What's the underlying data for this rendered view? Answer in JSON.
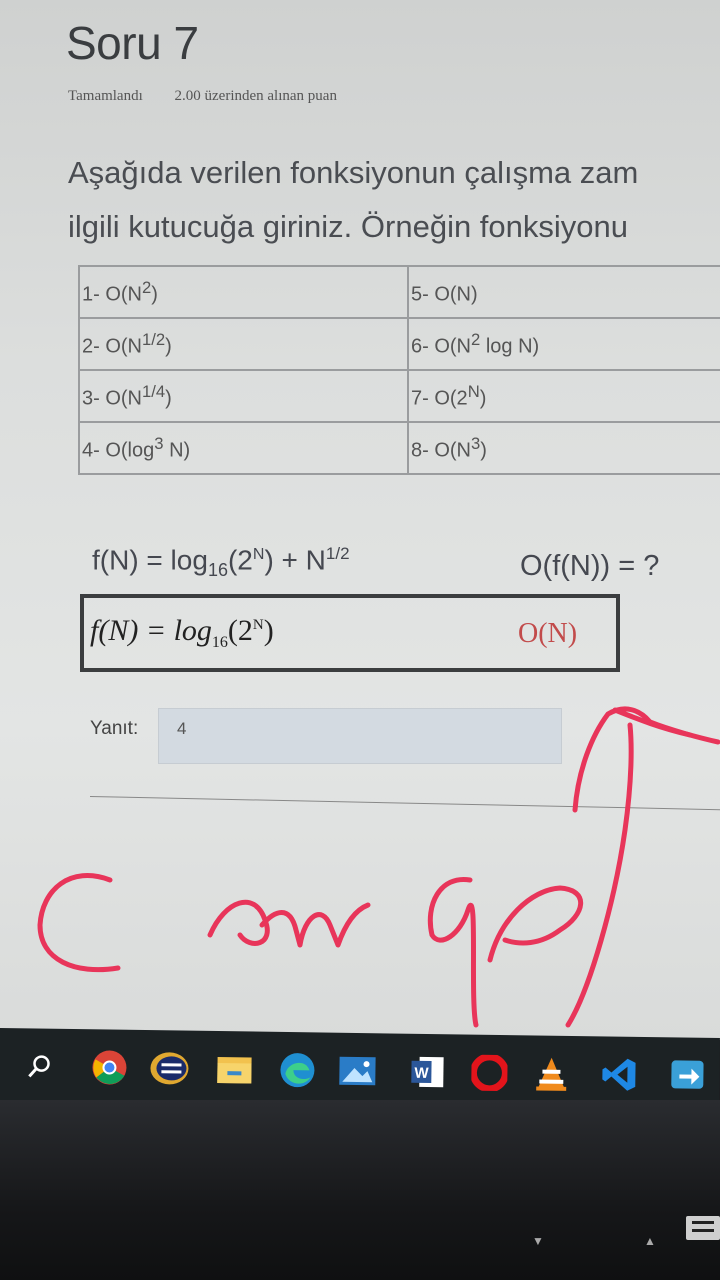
{
  "question": {
    "title": "Soru 7",
    "status": "Tamamlandı",
    "points": "2.00 üzerinden alınan puan",
    "text_line1": "Aşağıda verilen fonksiyonun çalışma zam",
    "text_line2": "ilgili kutucuğa giriniz. Örneğin fonksiyonu"
  },
  "options": {
    "o1": {
      "pre": "1- O(N",
      "sup": "2",
      "post": ")"
    },
    "o2": {
      "pre": "2- O(N",
      "sup": "1/2",
      "post": ")"
    },
    "o3": {
      "pre": "3- O(N",
      "sup": "1/4",
      "post": ")"
    },
    "o4": {
      "pre": "4- O(log",
      "sup": "3",
      "post": " N)"
    },
    "o5": {
      "pre": "5- O(N)",
      "sup": "",
      "post": ""
    },
    "o6": {
      "pre": "6- O(N",
      "sup": "2",
      "post": " log N)"
    },
    "o7": {
      "pre": "7- O(2",
      "sup": "N",
      "post": ")"
    },
    "o8": {
      "pre": "8- O(N",
      "sup": "3",
      "post": ")"
    }
  },
  "formula": {
    "lhs": "f(N) = log",
    "base": "16",
    "arg_open": "(2",
    "arg_exp": "N",
    "arg_close": ") + N",
    "root_exp": "1/2",
    "ofn": "O(f(N)) = ?"
  },
  "handwritten_box": {
    "lhs": "f(N) = log",
    "base": "16",
    "arg_open": "(2",
    "arg_exp": "N",
    "arg_close": ")",
    "answer": "O(N)"
  },
  "answer": {
    "label": "Yanıt:",
    "value": "4"
  },
  "taskbar": {
    "items": [
      "search-icon",
      "chrome-icon",
      "app-icon",
      "file-explorer-icon",
      "edge-icon",
      "photos-icon",
      "word-icon",
      "opera-icon",
      "vlc-icon",
      "vscode-icon",
      "remote-desktop-icon"
    ]
  },
  "colors": {
    "scribble": "#e8355a",
    "answer_red": "#c24b4b",
    "taskbar": "#1c2224"
  }
}
